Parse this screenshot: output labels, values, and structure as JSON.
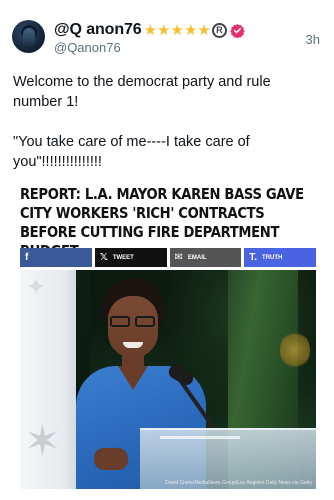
{
  "author": {
    "display_name": "@Q anon76",
    "stars": "★★★★★",
    "registered_mark": "R",
    "handle": "@Qanon76",
    "avatar_icon": "hooded-figure-avatar"
  },
  "timestamp": "3h",
  "post": {
    "line1": "Welcome to the democrat party and rule number 1!",
    "line2": "\"You take care of me----I take care of you\"!!!!!!!!!!!!!!!"
  },
  "article": {
    "headline": "REPORT: L.A. MAYOR KAREN BASS GAVE CITY WORKERS 'RICH' CONTRACTS BEFORE CUTTING FIRE DEPARTMENT BUDGET",
    "share_buttons": [
      {
        "icon": "f",
        "label": ""
      },
      {
        "icon": "𝕏",
        "label": "TWEET"
      },
      {
        "icon": "✉",
        "label": "EMAIL"
      },
      {
        "icon": "T.",
        "label": "TRUTH"
      }
    ],
    "photo_credit": "David Crane/MediaNews Group/Los Angeles Daily News via Getty"
  },
  "colors": {
    "star": "#f4c12e",
    "verified": "#e5306a",
    "facebook": "#3b5998",
    "truth": "#4a63e0"
  }
}
